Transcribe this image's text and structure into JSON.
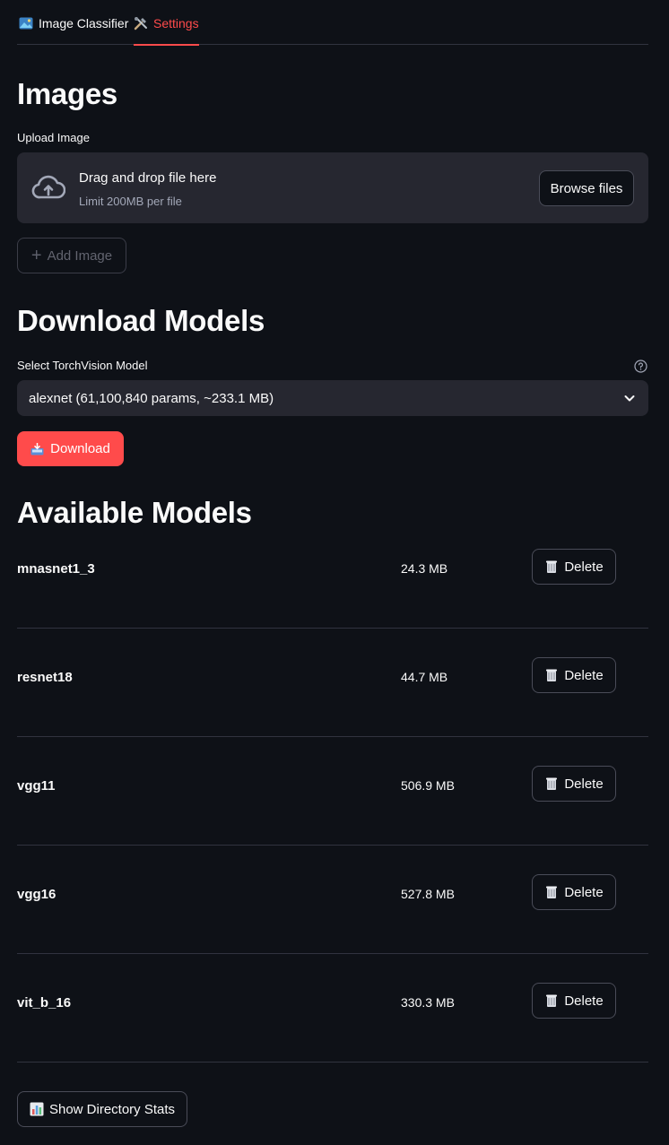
{
  "tabs": [
    {
      "label": "Image Classifier",
      "icon": "image-icon",
      "active": false
    },
    {
      "label": "Settings",
      "icon": "tools-icon",
      "active": true
    }
  ],
  "images": {
    "title": "Images",
    "upload_label": "Upload Image",
    "drop_text": "Drag and drop file here",
    "limit_text": "Limit 200MB per file",
    "browse_label": "Browse files",
    "add_label": "Add Image"
  },
  "download_models": {
    "title": "Download Models",
    "select_label": "Select TorchVision Model",
    "selected": "alexnet (61,100,840 params, ~233.1 MB)",
    "download_label": "Download"
  },
  "available_models": {
    "title": "Available Models",
    "delete_label": "Delete",
    "items": [
      {
        "name": "mnasnet1_3",
        "size": "24.3 MB"
      },
      {
        "name": "resnet18",
        "size": "44.7 MB"
      },
      {
        "name": "vgg11",
        "size": "506.9 MB"
      },
      {
        "name": "vgg16",
        "size": "527.8 MB"
      },
      {
        "name": "vit_b_16",
        "size": "330.3 MB"
      }
    ]
  },
  "stats_label": "Show Directory Stats",
  "colors": {
    "accent": "#ff4b4b",
    "background": "#0e1117",
    "surface": "#262730"
  }
}
